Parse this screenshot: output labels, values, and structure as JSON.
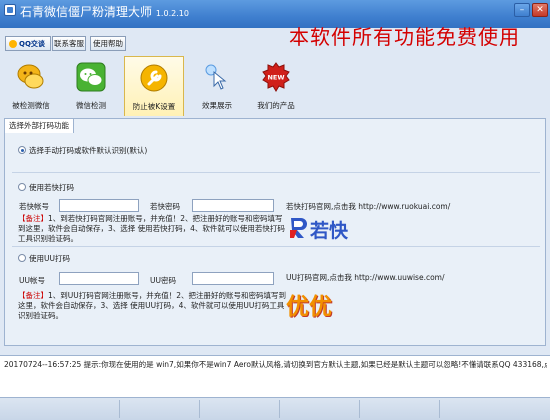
{
  "window": {
    "title": "石青微信僵尸粉清理大师",
    "version": "1.0.2.10"
  },
  "top_buttons": {
    "qq_label": "QQ交谈",
    "contact_label": "联系客服",
    "help_label": "使用帮助"
  },
  "promo_text": "本软件所有功能免费使用",
  "toolbar": {
    "items": [
      {
        "label": "被检测微信",
        "icon": "chat-bubbles-icon"
      },
      {
        "label": "微信检测",
        "icon": "wechat-icon"
      },
      {
        "label": "防止被K设置",
        "icon": "wrench-icon"
      },
      {
        "label": "效果展示",
        "icon": "pointer-hand-icon"
      },
      {
        "label": "我们的产品",
        "icon": "new-badge-icon"
      }
    ],
    "active_index": 2
  },
  "tab": {
    "label": "选择外部打码功能"
  },
  "options": {
    "manual_label": "选择手动打码或软件默认识别(默认)",
    "ruokuai": {
      "label": "使用若快打码",
      "account_label": "若快帐号",
      "password_label": "若快密码",
      "site_link": "若快打码官网,点击我 http://www.ruokuai.com/",
      "note_prefix": "【备注】",
      "note_body": "1、到若快打码官网注册账号，并充值！2、把注册好的账号和密码填写到这里，软件会自动保存，3、选择 使用若快打码，4、软件就可以使用若快打码工具识别验证码。",
      "logo_text": "若快"
    },
    "uu": {
      "label": "使用UU打码",
      "account_label": "UU帐号",
      "password_label": "UU密码",
      "site_link": "UU打码官网,点击我 http://www.uuwise.com/",
      "note_prefix": "【备注】",
      "note_body": "1、到UU打码官网注册账号，并充值！2、把注册好的账号和密码填写到这里，软件会自动保存，3、选择 使用UU打码，4、软件就可以使用UU打码工具识别验证码。",
      "logo_text": "优优"
    },
    "selected": "manual"
  },
  "status": {
    "message": "20170724--16:57:25  提示:你现在使用的是 win7,如果你不是win7 Aero默认风格,请切换到官方默认主题,如果已经是默认主题可以忽略!不懂请联系QQ 433168,点击打开帮助#http"
  },
  "colors": {
    "title_bar": "#3f7fcf",
    "promo_red": "#d40000",
    "note_red": "#cc0000"
  }
}
